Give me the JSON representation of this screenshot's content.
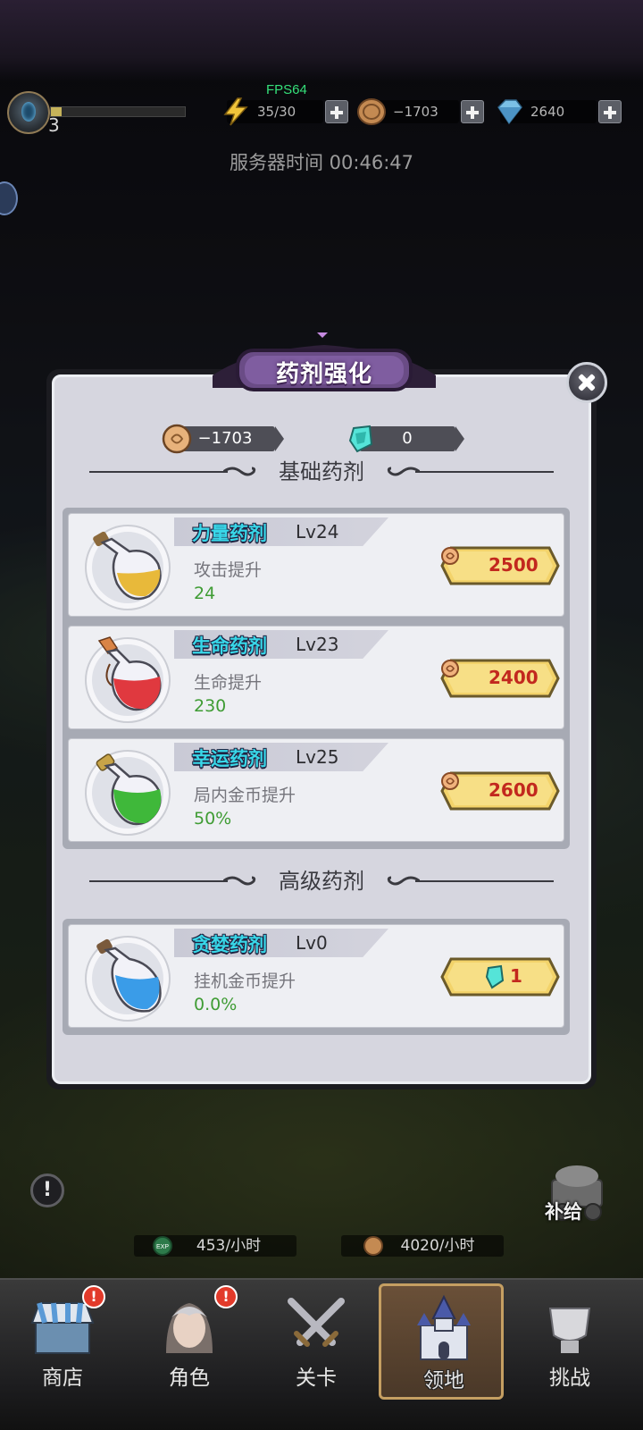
{
  "topbar": {
    "fps": "FPS64",
    "player_level": "3",
    "xp_fraction": 0.08,
    "energy": "35/30",
    "coins": "−1703",
    "gems": "2640",
    "server_time_label": "服务器时间",
    "server_time": "00:46:47"
  },
  "modal": {
    "title": "药剂强化",
    "coin_balance": "−1703",
    "gem_balance": "0",
    "section_basic": "基础药剂",
    "section_advanced": "高级药剂",
    "basic_potions": [
      {
        "name": "力量药剂",
        "level": "Lv24",
        "desc": "攻击提升",
        "value": "24",
        "price": "2500",
        "currency": "coin",
        "color": "#e8b93a"
      },
      {
        "name": "生命药剂",
        "level": "Lv23",
        "desc": "生命提升",
        "value": "230",
        "price": "2400",
        "currency": "coin",
        "color": "#e0393f"
      },
      {
        "name": "幸运药剂",
        "level": "Lv25",
        "desc": "局内金币提升",
        "value": "50%",
        "price": "2600",
        "currency": "coin",
        "color": "#3fb83a"
      }
    ],
    "advanced_potions": [
      {
        "name": "贪婪药剂",
        "level": "Lv0",
        "desc": "挂机金币提升",
        "value": "0.0%",
        "price": "1",
        "currency": "gem",
        "color": "#3a9ce8"
      }
    ]
  },
  "idle": {
    "exp_rate": "453/小时",
    "coin_rate": "4020/小时",
    "supply_label": "补给"
  },
  "nav": {
    "shop": "商店",
    "character": "角色",
    "stage": "关卡",
    "territory": "领地",
    "challenge": "挑战",
    "alert_mark": "!"
  },
  "colors": {
    "potion_name": "#38d7e8",
    "value_green": "#3f9c34",
    "price_red": "#c2281e",
    "button_gold": "#f3d36a"
  }
}
